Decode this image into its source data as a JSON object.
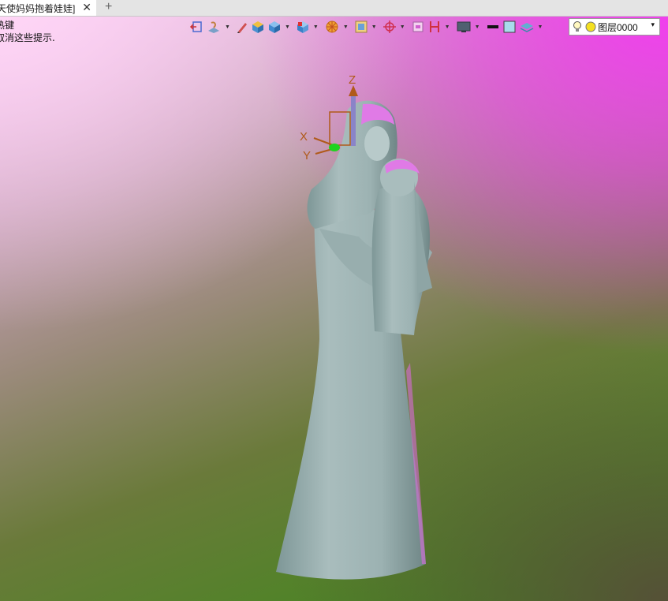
{
  "tab": {
    "title": "天使妈妈抱着娃娃]",
    "close": "✕",
    "add": "+"
  },
  "hint": {
    "line1": "热键",
    "line2": "取消这些提示."
  },
  "axes": {
    "z": "Z",
    "x": "X",
    "y": "Y"
  },
  "layer": {
    "label": "图层0000",
    "dropdown": "▾"
  },
  "colors": {
    "figure": "#9fb3b3",
    "highlight": "#e070e0",
    "axis": "#b05a1a"
  }
}
